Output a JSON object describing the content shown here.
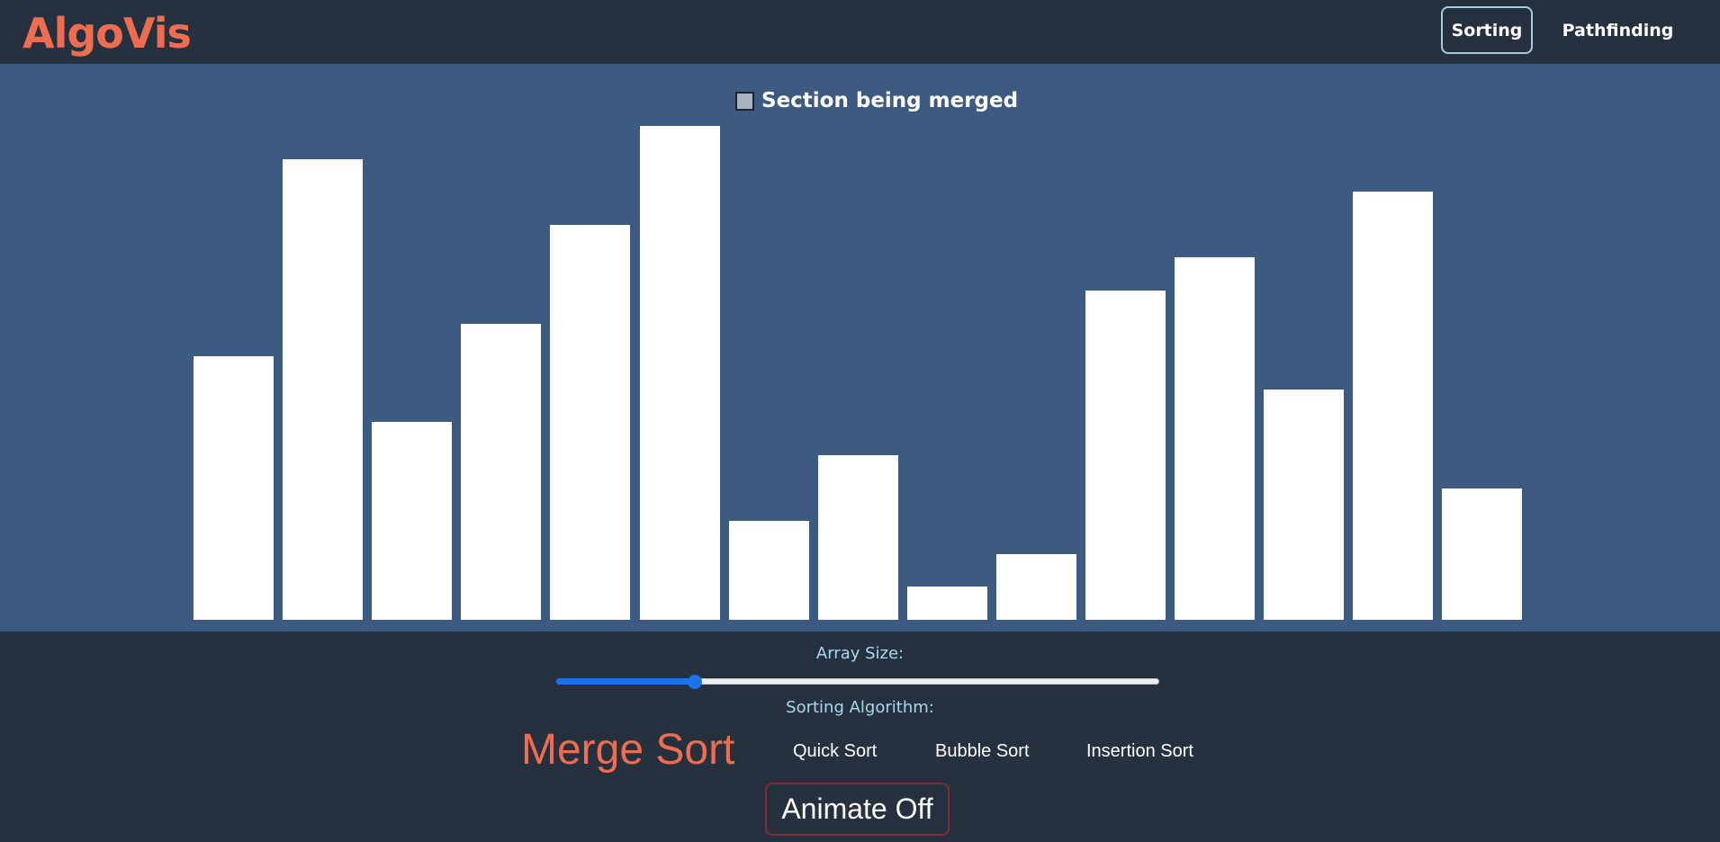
{
  "header": {
    "logo": "AlgoVis",
    "nav": [
      {
        "label": "Sorting",
        "active": true
      },
      {
        "label": "Pathfinding",
        "active": false
      }
    ]
  },
  "legend": {
    "label": "Section being merged",
    "swatch_color": "#a8b3c0"
  },
  "bars": {
    "color": "#ffffff",
    "values": [
      8,
      14,
      6,
      9,
      12,
      15,
      3,
      5,
      1,
      2,
      10,
      11,
      7,
      13,
      4
    ],
    "max_value": 15
  },
  "controls": {
    "array_size_label": "Array Size:",
    "array_size_fraction": 0.23,
    "algorithm_label": "Sorting Algorithm:",
    "algorithms": [
      {
        "label": "Merge Sort",
        "selected": true
      },
      {
        "label": "Quick Sort",
        "selected": false
      },
      {
        "label": "Bubble Sort",
        "selected": false
      },
      {
        "label": "Insertion Sort",
        "selected": false
      }
    ],
    "animate_button": "Animate Off"
  },
  "colors": {
    "accent": "#ee6d50",
    "background": "#263140",
    "viz_background": "#3d5b80",
    "slider": "#1a73e8"
  }
}
